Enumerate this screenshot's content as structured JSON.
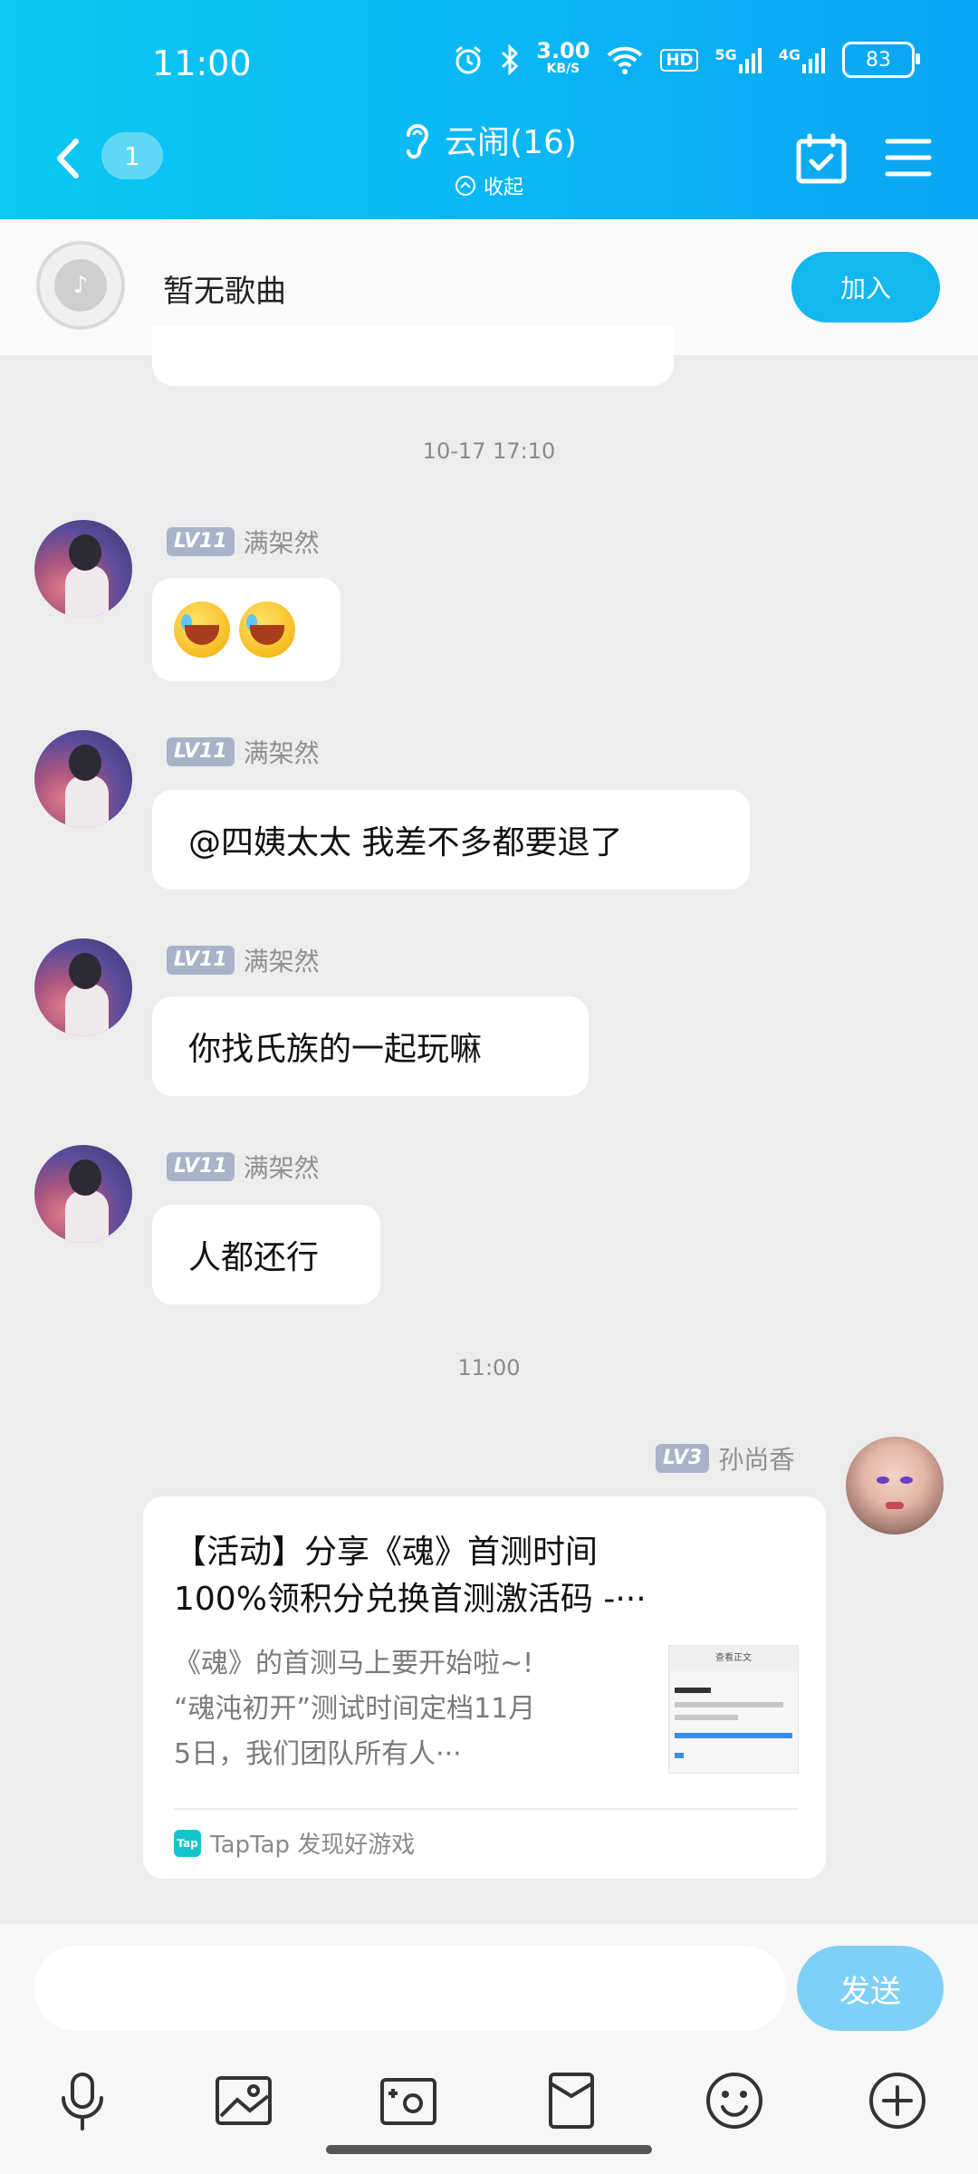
{
  "status_bar": {
    "time": "11:00",
    "net_speed_value": "3.00",
    "net_speed_unit": "KB/S",
    "hd": "HD",
    "sig1": "5G",
    "sig2": "4G",
    "battery": "83"
  },
  "header": {
    "unread": "1",
    "title": "云闹(16)",
    "collapse_label": "收起"
  },
  "music": {
    "song": "暂无歌曲",
    "join_label": "加入"
  },
  "timestamps": [
    "10-17 17:10",
    "11:00"
  ],
  "messages": [
    {
      "level": "LV11",
      "name": "满架然",
      "type": "emoji"
    },
    {
      "level": "LV11",
      "name": "满架然",
      "text": "@四姨太太 我差不多都要退了"
    },
    {
      "level": "LV11",
      "name": "满架然",
      "text": "你找氏族的一起玩嘛"
    },
    {
      "level": "LV11",
      "name": "满架然",
      "text": "人都还行"
    }
  ],
  "own_message": {
    "level": "LV3",
    "name": "孙尚香",
    "card": {
      "title_line1": "【活动】分享《魂》首测时间",
      "title_line2": "100%领积分兑换首测激活码 -···",
      "desc_line1": "《魂》的首测马上要开始啦~!",
      "desc_line2": "“魂沌初开”测试时间定档11月",
      "desc_line3": "5日，我们团队所有人···",
      "thumb_heading": "查看正文",
      "source_icon": "Tap",
      "source": "TapTap 发现好游戏"
    }
  },
  "composer": {
    "send_label": "发送"
  },
  "colors": {
    "header_start": "#0cc8f2",
    "header_end": "#0aa5f3",
    "join": "#12b8ee",
    "send": "#7fd0f6",
    "level_badge": "#a9b3c8"
  }
}
